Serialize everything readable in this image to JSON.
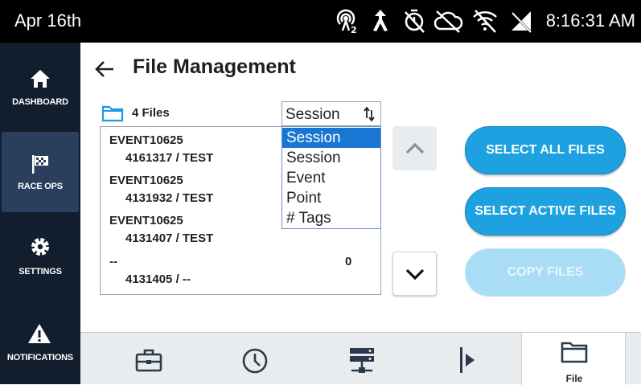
{
  "status_bar": {
    "date": "Apr 16th",
    "time": "8:16:31 AM",
    "icons": [
      "broadcast-2-icon",
      "person-arrow-icon",
      "timer-off-icon",
      "cloud-off-icon",
      "wifi-off-icon",
      "signal-off-icon"
    ]
  },
  "sidebar": {
    "items": [
      {
        "label": "DASHBOARD",
        "icon": "home-icon"
      },
      {
        "label": "RACE OPS",
        "icon": "checkered-flag-icon"
      },
      {
        "label": "SETTINGS",
        "icon": "gear-icon"
      },
      {
        "label": "NOTIFICATIONS",
        "icon": "warning-icon"
      }
    ],
    "active": "RACE OPS"
  },
  "header": {
    "title": "File Management"
  },
  "file_summary": {
    "count_label": "4 Files"
  },
  "sort_select": {
    "value": "Session",
    "options": [
      "Session",
      "Session",
      "Event",
      "Point",
      "# Tags"
    ],
    "highlighted_index": 0
  },
  "files": [
    {
      "name": "EVENT10625",
      "sub": "4161317 / TEST",
      "count": ""
    },
    {
      "name": "EVENT10625",
      "sub": "4131932 / TEST",
      "count": ""
    },
    {
      "name": "EVENT10625",
      "sub": "4131407 / TEST",
      "count": ""
    },
    {
      "name": "--",
      "sub": "4131405 / --",
      "count": "0"
    }
  ],
  "actions": {
    "select_all": "SELECT ALL FILES",
    "select_active": "SELECT ACTIVE FILES",
    "copy": "COPY FILES"
  },
  "bottom_tabs": [
    {
      "icon": "briefcase-icon",
      "label": ""
    },
    {
      "icon": "clock-icon",
      "label": ""
    },
    {
      "icon": "server-network-icon",
      "label": ""
    },
    {
      "icon": "play-bar-icon",
      "label": ""
    },
    {
      "icon": "folder-icon",
      "label": "File"
    }
  ],
  "colors": {
    "sidebar_bg": "#121e2e",
    "sidebar_active": "#2a3f5c",
    "accent_blue": "#1ea1e0",
    "disabled_blue": "#a9dcf5",
    "dropdown_highlight": "#1976d2"
  }
}
